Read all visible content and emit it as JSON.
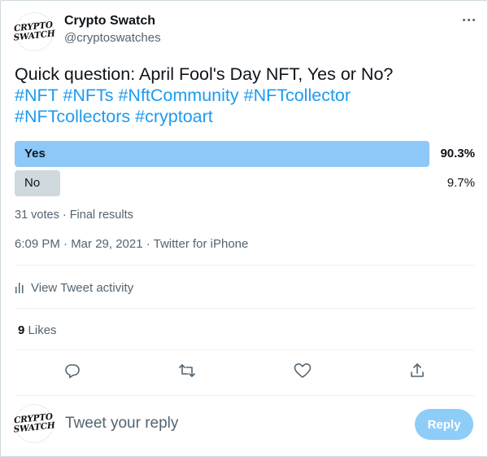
{
  "author": {
    "name": "Crypto Swatch",
    "handle": "@cryptoswatches",
    "avatar_line1": "CRYPTO",
    "avatar_line2": "SWATCH"
  },
  "tweet": {
    "text": "Quick question: April Fool's Day NFT, Yes or No?",
    "hashtags": [
      "#NFT",
      "#NFTs",
      "#NftCommunity",
      "#NFTcollector",
      "#NFTcollectors",
      "#cryptoart"
    ]
  },
  "poll": {
    "options": [
      {
        "label": "Yes",
        "percent": "90.3%",
        "fraction": 0.903,
        "winner": true
      },
      {
        "label": "No",
        "percent": "9.7%",
        "fraction": 0.097,
        "winner": false
      }
    ],
    "summary": "31 votes · Final results"
  },
  "meta": "6:09 PM · Mar 29, 2021 · Twitter for iPhone",
  "activity_label": "View Tweet activity",
  "likes": {
    "count": "9",
    "label": "Likes"
  },
  "reply": {
    "placeholder": "Tweet your reply",
    "button_label": "Reply"
  },
  "colors": {
    "accent": "#1d9bf0",
    "poll_winner": "#8ec8f9",
    "poll_other": "#cfd9de",
    "reply_button": "#8ecdf8"
  }
}
